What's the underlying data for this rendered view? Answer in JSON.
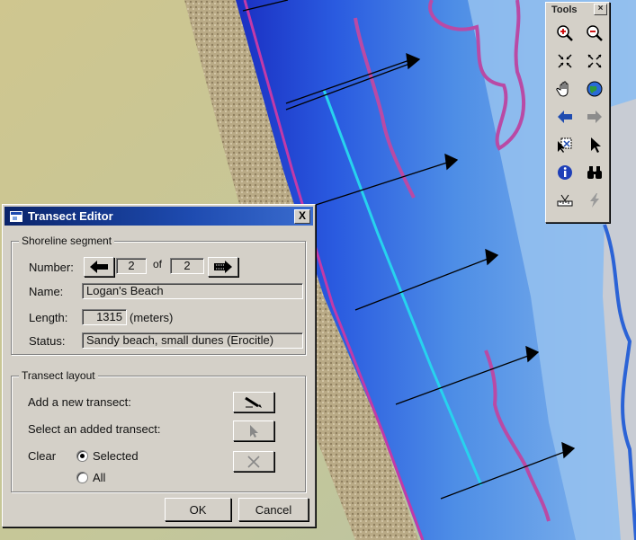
{
  "tools": {
    "title": "Tools",
    "buttons": [
      "zoom-in-icon",
      "zoom-out-icon",
      "fixed-zoom-in-icon",
      "fixed-zoom-out-icon",
      "pan-hand-icon",
      "full-extent-globe-icon",
      "back-arrow-icon",
      "forward-arrow-icon",
      "select-features-icon",
      "pointer-icon",
      "identify-icon",
      "find-binoculars-icon",
      "measure-icon",
      "hyperlink-lightning-icon"
    ]
  },
  "dialog": {
    "title": "Transect Editor",
    "close": "X",
    "shoreline": {
      "legend": "Shoreline segment",
      "number_label": "Number:",
      "number_value": "2",
      "of_label": "of",
      "total_value": "2",
      "name_label": "Name:",
      "name_value": "Logan's Beach",
      "length_label": "Length:",
      "length_value": "1315",
      "length_unit": "(meters)",
      "status_label": "Status:",
      "status_value": "Sandy beach, small dunes (Erocitle)"
    },
    "layout": {
      "legend": "Transect layout",
      "add_label": "Add a new transect:",
      "select_label": "Select an added transect:",
      "clear_label": "Clear",
      "radio_selected": "Selected",
      "radio_all": "All"
    },
    "ok": "OK",
    "cancel": "Cancel"
  }
}
